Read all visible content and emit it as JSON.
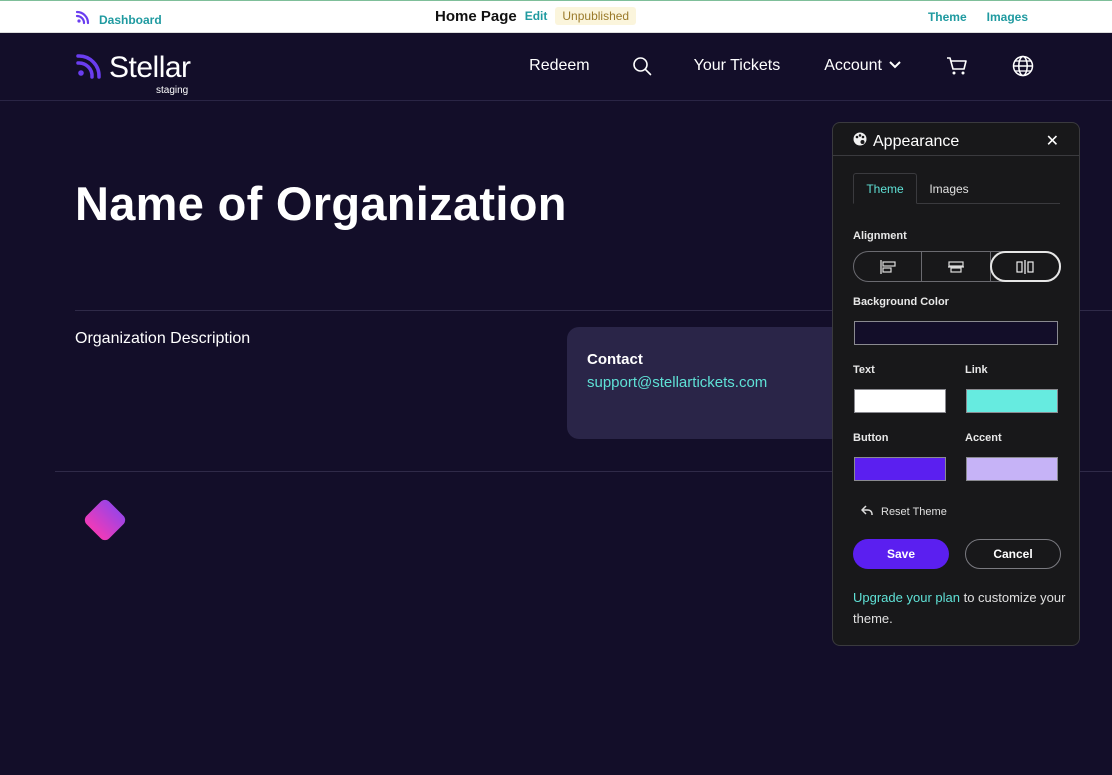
{
  "admin_bar": {
    "dashboard_label": "Dashboard",
    "page_title": "Home Page",
    "edit_label": "Edit",
    "status_badge": "Unpublished",
    "theme_label": "Theme",
    "images_label": "Images"
  },
  "header": {
    "logo_text": "Stellar",
    "logo_sub": "staging",
    "nav": {
      "redeem": "Redeem",
      "tickets": "Your Tickets",
      "account": "Account"
    }
  },
  "main": {
    "org_name": "Name of Organization",
    "org_description": "Organization Description",
    "contact_label": "Contact",
    "contact_email": "support@stellartickets.com"
  },
  "panel": {
    "title": "Appearance",
    "tabs": [
      {
        "label": "Theme",
        "active": true
      },
      {
        "label": "Images",
        "active": false
      }
    ],
    "alignment_label": "Alignment",
    "alignment_options": [
      "left-align",
      "center-align",
      "split-align"
    ],
    "alignment_selected": "split-align",
    "background_label": "Background Color",
    "text_label": "Text",
    "link_label": "Link",
    "button_label": "Button",
    "accent_label": "Accent",
    "colors": {
      "background": "#130e29",
      "text": "#ffffff",
      "link": "#66ebe0",
      "button": "#5b1ff0",
      "accent": "#c6b3f7"
    },
    "reset_label": "Reset Theme",
    "save_label": "Save",
    "cancel_label": "Cancel",
    "upgrade_link": "Upgrade your plan",
    "upgrade_text": " to customize your theme."
  }
}
